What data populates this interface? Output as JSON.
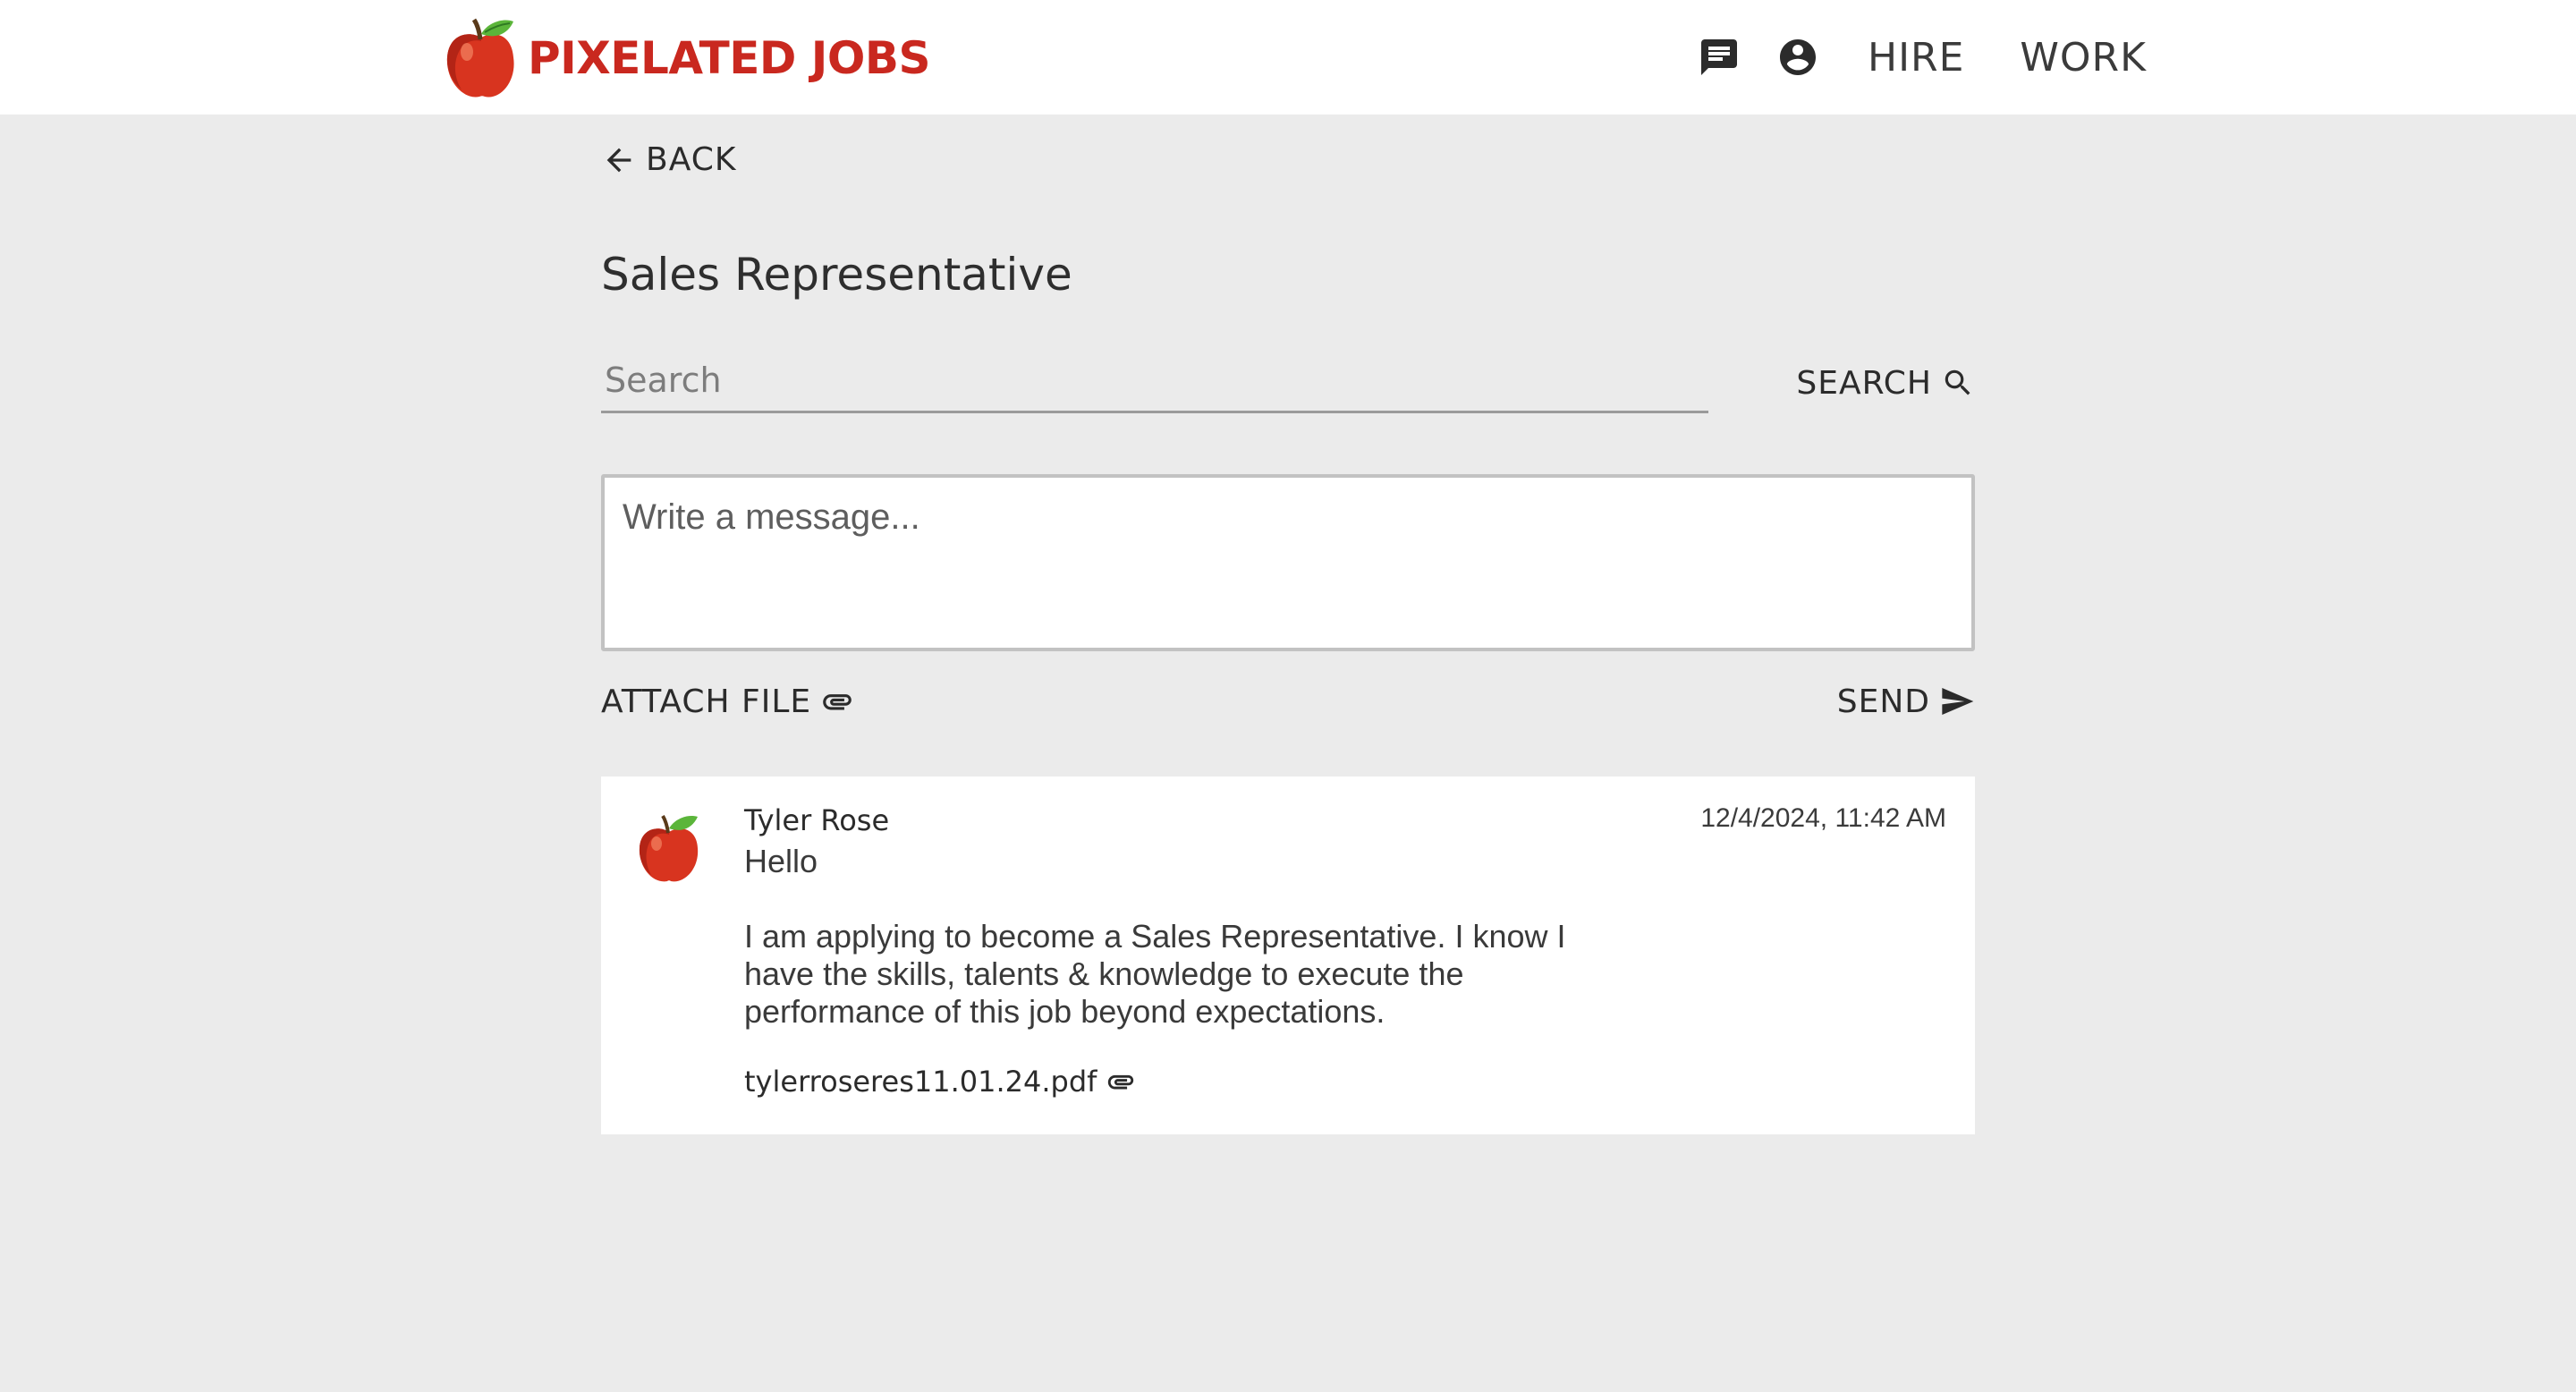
{
  "header": {
    "brand_name": "PIXELATED JOBS",
    "nav": {
      "messages_icon": "chat-icon",
      "account_icon": "account-circle-icon",
      "hire_label": "HIRE",
      "work_label": "WORK"
    }
  },
  "main": {
    "back_label": "BACK",
    "page_title": "Sales Representative",
    "search": {
      "placeholder": "Search",
      "value": "",
      "button_label": "SEARCH"
    },
    "composer": {
      "placeholder": "Write a message...",
      "value": "",
      "attach_label": "ATTACH FILE",
      "send_label": "SEND"
    },
    "messages": [
      {
        "sender": "Tyler Rose",
        "timestamp": "12/4/2024, 11:42 AM",
        "greeting": "Hello",
        "body": "I am applying to become a Sales Representative. I know I have the skills, talents & knowledge to execute the performance of this job beyond expectations.",
        "attachment": "tylerroseres11.01.24.pdf"
      }
    ]
  },
  "colors": {
    "brand_red": "#c9281f",
    "page_background": "#ebebeb",
    "surface": "#ffffff",
    "text": "#2b2b2b"
  }
}
